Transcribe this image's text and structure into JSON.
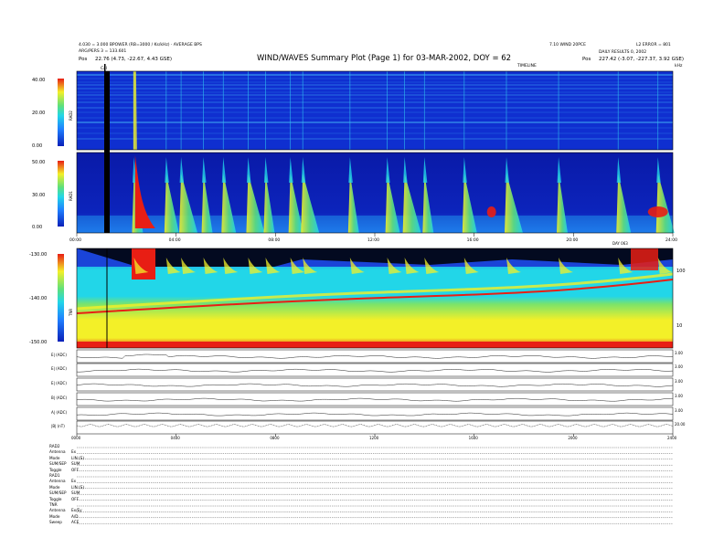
{
  "header": {
    "title": "WIND/WAVES Summary Plot (Page 1) for 03-MAR-2002, DOY = 62",
    "left_line1": "4.030 = 3.000 BPOWER (RB=3000 / Ks/kHz) · AVERAGE BPS",
    "left_line2": "ARG/PERS 3 = 133.601",
    "left_pos_label": "Pos",
    "left_pos_value": "22.76 (4.73, -22.67, 4.43 GSE)",
    "right_line1": "7.10 WIND 20PCE",
    "right_line2": "L2 ERROR = 801",
    "right_line3": "DAILY RESULTS 0, 2002",
    "right_pos_label": "Pos",
    "right_pos_value": "227.42 (-3.07, -227.37, 3.92 GSE)",
    "timeline_label": "TIMELINE",
    "cal_label": "Cal",
    "units_label": "kHz"
  },
  "panels": {
    "rad2": {
      "label": "RAD2",
      "ticks": [
        "40.00",
        "20.00",
        "0.00"
      ]
    },
    "rad1": {
      "label": "RAD1",
      "ticks": [
        "50.00",
        "30.00",
        "0.00"
      ]
    },
    "tnr": {
      "label": "TNR",
      "ticks": [
        "-130.00",
        "-140.00",
        "-150.00"
      ],
      "right_ticks": [
        "100",
        "10"
      ],
      "corner_label": "DAY 063"
    },
    "top_time_ticks": [
      "00:00",
      "04:00",
      "08:00",
      "12:00",
      "16:00",
      "20:00",
      "24:00"
    ],
    "bottom_time_ticks": [
      "0000",
      "0400",
      "0800",
      "1200",
      "1600",
      "2000",
      "2400"
    ],
    "lines": [
      {
        "label": "E| (ADC)",
        "right": "3.00"
      },
      {
        "label": "E| (ADC)",
        "right": "3.00"
      },
      {
        "label": "E| (ADC)",
        "right": "3.00"
      },
      {
        "label": "B| (ADC)",
        "right": "3.00"
      },
      {
        "label": "A| (ADC)",
        "right": "3.00"
      },
      {
        "label": "|B| (nT)",
        "right": "20.00"
      }
    ]
  },
  "settings": [
    {
      "k": "RAD2",
      "v": ""
    },
    {
      "k": "Antenna",
      "v": "Ex"
    },
    {
      "k": "Mode",
      "v": "LIN (S)"
    },
    {
      "k": "SUM/SEP",
      "v": "SUM"
    },
    {
      "k": "Toggle",
      "v": "OFF"
    },
    {
      "k": "RAD1",
      "v": ""
    },
    {
      "k": "Antenna",
      "v": "Ex"
    },
    {
      "k": "Mode",
      "v": "LIN (S)"
    },
    {
      "k": "SUM/SEP",
      "v": "SUM"
    },
    {
      "k": "Toggle",
      "v": "OFF"
    },
    {
      "k": "TNR",
      "v": ""
    },
    {
      "k": "Antenna",
      "v": "Ex/Ey"
    },
    {
      "k": "Mode",
      "v": "A/D"
    },
    {
      "k": "Sweep",
      "v": "ACE"
    }
  ],
  "colors": {
    "deep_blue": "#0a1fb8",
    "blue": "#1f4fe8",
    "cyan": "#22d6e8",
    "green": "#5fe07a",
    "yellow": "#f3f028",
    "red": "#e81e14",
    "black": "#000000"
  },
  "chart_data": [
    {
      "type": "heatmap",
      "panel": "RAD2",
      "ylabel": "RAD2",
      "ylim": [
        0,
        40
      ],
      "x_range_hours": [
        0,
        24
      ],
      "features": "dense horizontal interference lines; faint vertical bursts"
    },
    {
      "type": "heatmap",
      "panel": "RAD1",
      "ylabel": "RAD1",
      "ylim": [
        0,
        50
      ],
      "x_range_hours": [
        0,
        24
      ],
      "bursts_hours": [
        2.3,
        3.6,
        4.2,
        5.1,
        5.9,
        6.9,
        7.6,
        8.6,
        9.1,
        11.0,
        12.5,
        13.2,
        14.0,
        15.6,
        17.3,
        19.4,
        21.8,
        23.4
      ]
    },
    {
      "type": "heatmap",
      "panel": "TNR",
      "ylabel": "TNR",
      "ylim": [
        -150,
        -130
      ],
      "x_range_hours": [
        0,
        24
      ]
    },
    {
      "type": "line",
      "panel": "time series",
      "series_count": 6,
      "x_range_hours": [
        0,
        24
      ]
    }
  ]
}
